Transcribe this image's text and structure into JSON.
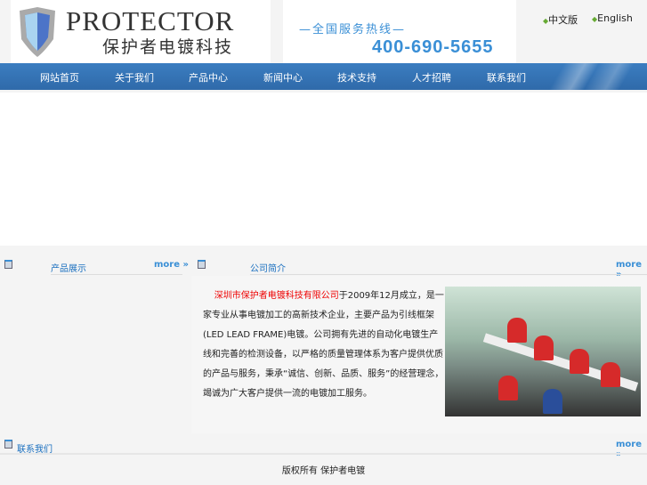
{
  "header": {
    "brand": "PROTECTOR",
    "brand_cn": "保护者电镀科技",
    "hotline_label": "—全国服务热线—",
    "phone": "400-690-5655",
    "lang_cn": "中文版",
    "lang_en": "English"
  },
  "nav": [
    "网站首页",
    "关于我们",
    "产品中心",
    "新闻中心",
    "技术支持",
    "人才招聘",
    "联系我们"
  ],
  "sections": {
    "products": "产品展示",
    "about": "公司简介",
    "contact": "联系我们",
    "more": "more »"
  },
  "intro": {
    "company": "深圳市保护者电镀科技有限公司",
    "text": "于2009年12月成立，是一家专业从事电镀加工的高新技术企业，主要产品为引线框架(LED LEAD FRAME)电镀。公司拥有先进的自动化电镀生产线和完善的检测设备，以严格的质量管理体系为客户提供优质的产品与服务，秉承“诚信、创新、品质、服务”的经营理念，竭诚为广大客户提供一流的电镀加工服务。"
  },
  "footer": "版权所有 保护者电镀"
}
